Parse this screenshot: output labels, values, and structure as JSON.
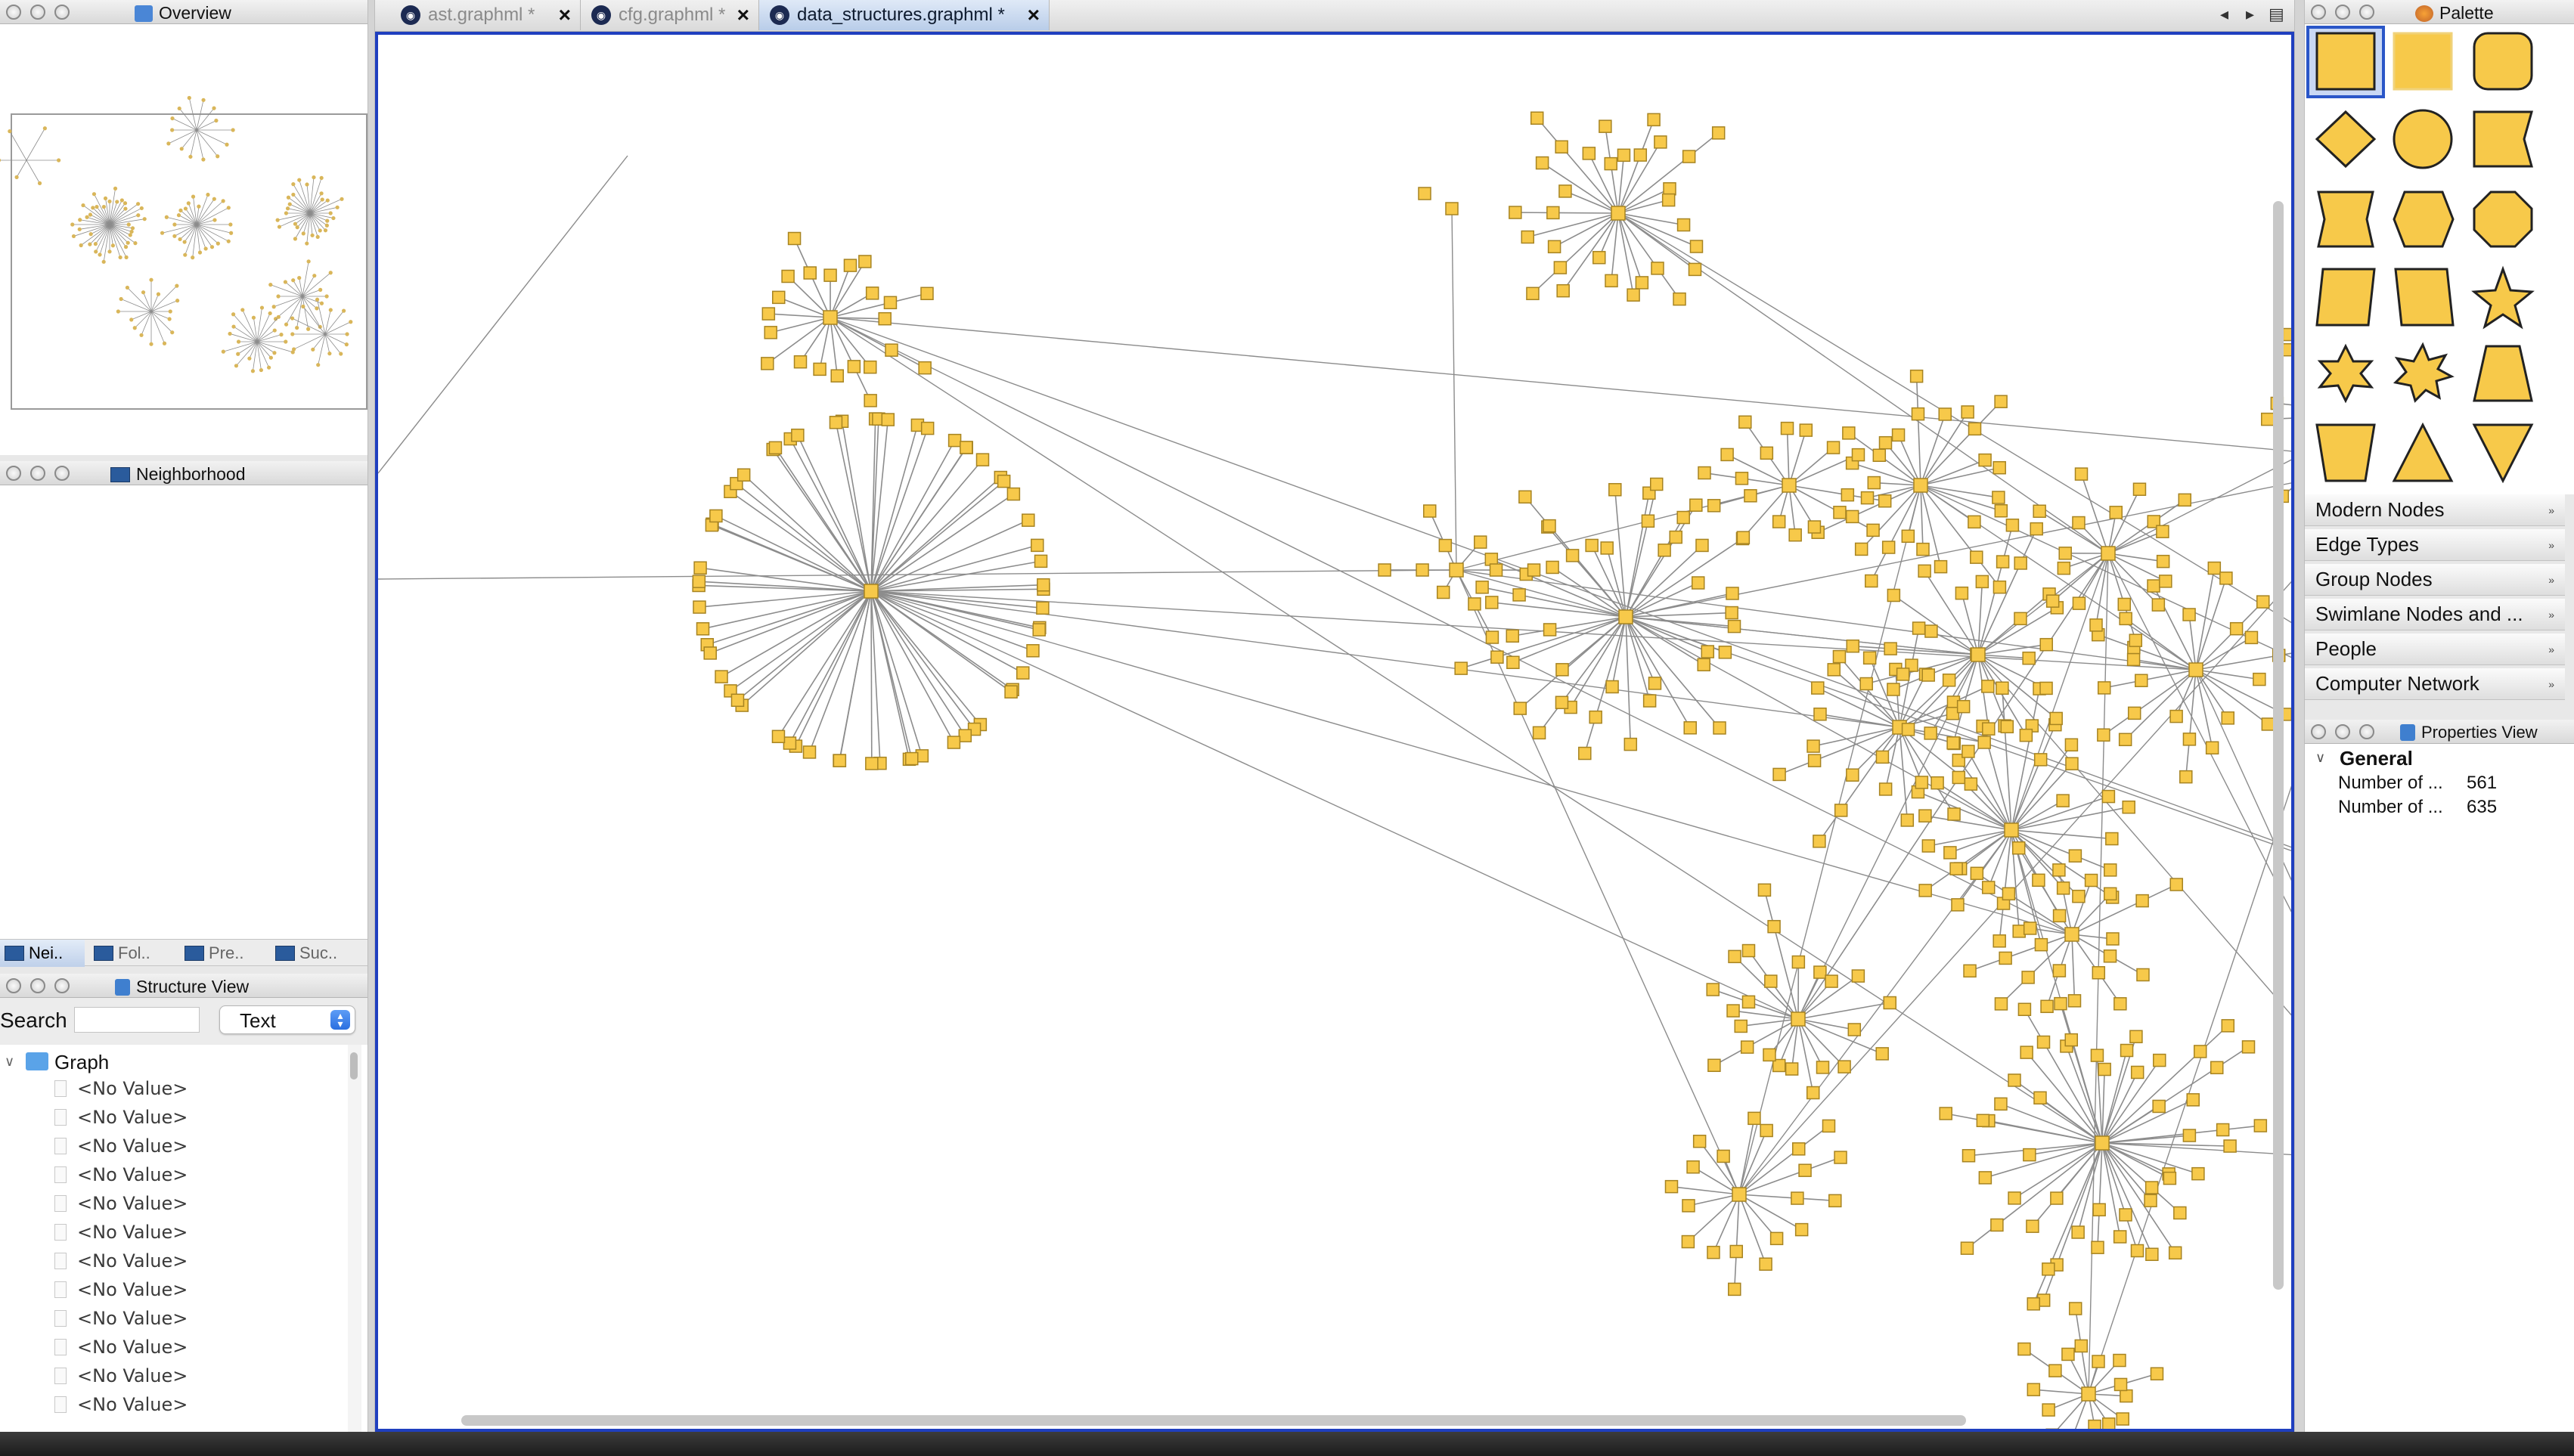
{
  "overview": {
    "title": "Overview"
  },
  "neighborhood": {
    "title": "Neighborhood"
  },
  "bottom_tabs": [
    {
      "label": "Nei.."
    },
    {
      "label": "Fol.."
    },
    {
      "label": "Pre.."
    },
    {
      "label": "Suc.."
    }
  ],
  "structure_view": {
    "title": "Structure View",
    "search_label": "Search",
    "search_value": "",
    "mode_value": "Text",
    "root_label": "Graph",
    "items": [
      "<No Value>",
      "<No Value>",
      "<No Value>",
      "<No Value>",
      "<No Value>",
      "<No Value>",
      "<No Value>",
      "<No Value>",
      "<No Value>",
      "<No Value>",
      "<No Value>",
      "<No Value>"
    ]
  },
  "editor": {
    "tabs": [
      {
        "label": "ast.graphml *",
        "active": false
      },
      {
        "label": "cfg.graphml *",
        "active": false
      },
      {
        "label": "data_structures.graphml *",
        "active": true
      }
    ]
  },
  "palette": {
    "title": "Palette",
    "sections": [
      "Modern Nodes",
      "Edge Types",
      "Group Nodes",
      "Swimlane Nodes and ...",
      "People",
      "Computer Network"
    ]
  },
  "properties": {
    "title": "Properties View",
    "group": "General",
    "rows": [
      {
        "key": "Number of ...",
        "value": "561"
      },
      {
        "key": "Number of ...",
        "value": "635"
      }
    ]
  },
  "colors": {
    "node_fill": "#f7c94a",
    "node_stroke": "#a78422",
    "selection": "#1f3fbf",
    "edge": "#8c8c8c"
  }
}
